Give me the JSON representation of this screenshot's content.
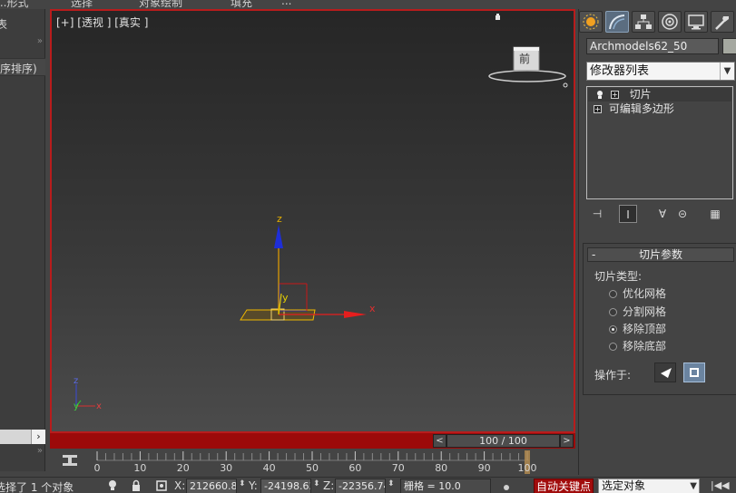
{
  "menubar": {
    "items": [
      "...形式",
      "选择",
      "对象绘制",
      "填充",
      "..."
    ]
  },
  "left_panel": {
    "label_top": "表",
    "sort_label": "序排序)",
    "arrows": "»"
  },
  "viewport": {
    "label": "[+] [透视 ] [真实 ]",
    "viewcube_face": "前",
    "axis_labels": {
      "x": "x",
      "y": "y",
      "z": "z"
    },
    "border_color": "#b81c1c"
  },
  "time_slider": {
    "frame_display": "100 / 100",
    "prev_label": "<",
    "next_label": ">",
    "color": "#9c0a0a"
  },
  "timeline": {
    "ticks": [
      "0",
      "10",
      "20",
      "30",
      "40",
      "50",
      "60",
      "70",
      "80",
      "90",
      "100"
    ]
  },
  "status_bar": {
    "selection_text": "选择了 1 个对象",
    "x_label": "X:",
    "x_value": "212660.81",
    "y_label": "Y:",
    "y_value": "-24198.63",
    "z_label": "Z:",
    "z_value": "-22356.74",
    "grid_text": "栅格 = 10.0",
    "autokey_label": "自动关键点",
    "selection_dropdown": "选定对象",
    "nav_icon": "|◀◀"
  },
  "command_panel": {
    "tabs": [
      "create-icon",
      "modify-icon",
      "hierarchy-icon",
      "motion-icon",
      "display-icon",
      "utilities-icon"
    ],
    "object_name": "Archmodels62_50",
    "object_color": "#a5a8a0",
    "modifier_list_label": "修改器列表",
    "stack": [
      {
        "label": "切片"
      },
      {
        "label": "可编辑多边形"
      }
    ],
    "rollout": {
      "title": "切片参数",
      "collapse": "-",
      "slice_type_label": "切片类型:",
      "options": [
        {
          "label": "优化网格",
          "checked": false
        },
        {
          "label": "分割网格",
          "checked": false
        },
        {
          "label": "移除顶部",
          "checked": true
        },
        {
          "label": "移除底部",
          "checked": false
        }
      ],
      "operate_on_label": "操作于:"
    }
  }
}
